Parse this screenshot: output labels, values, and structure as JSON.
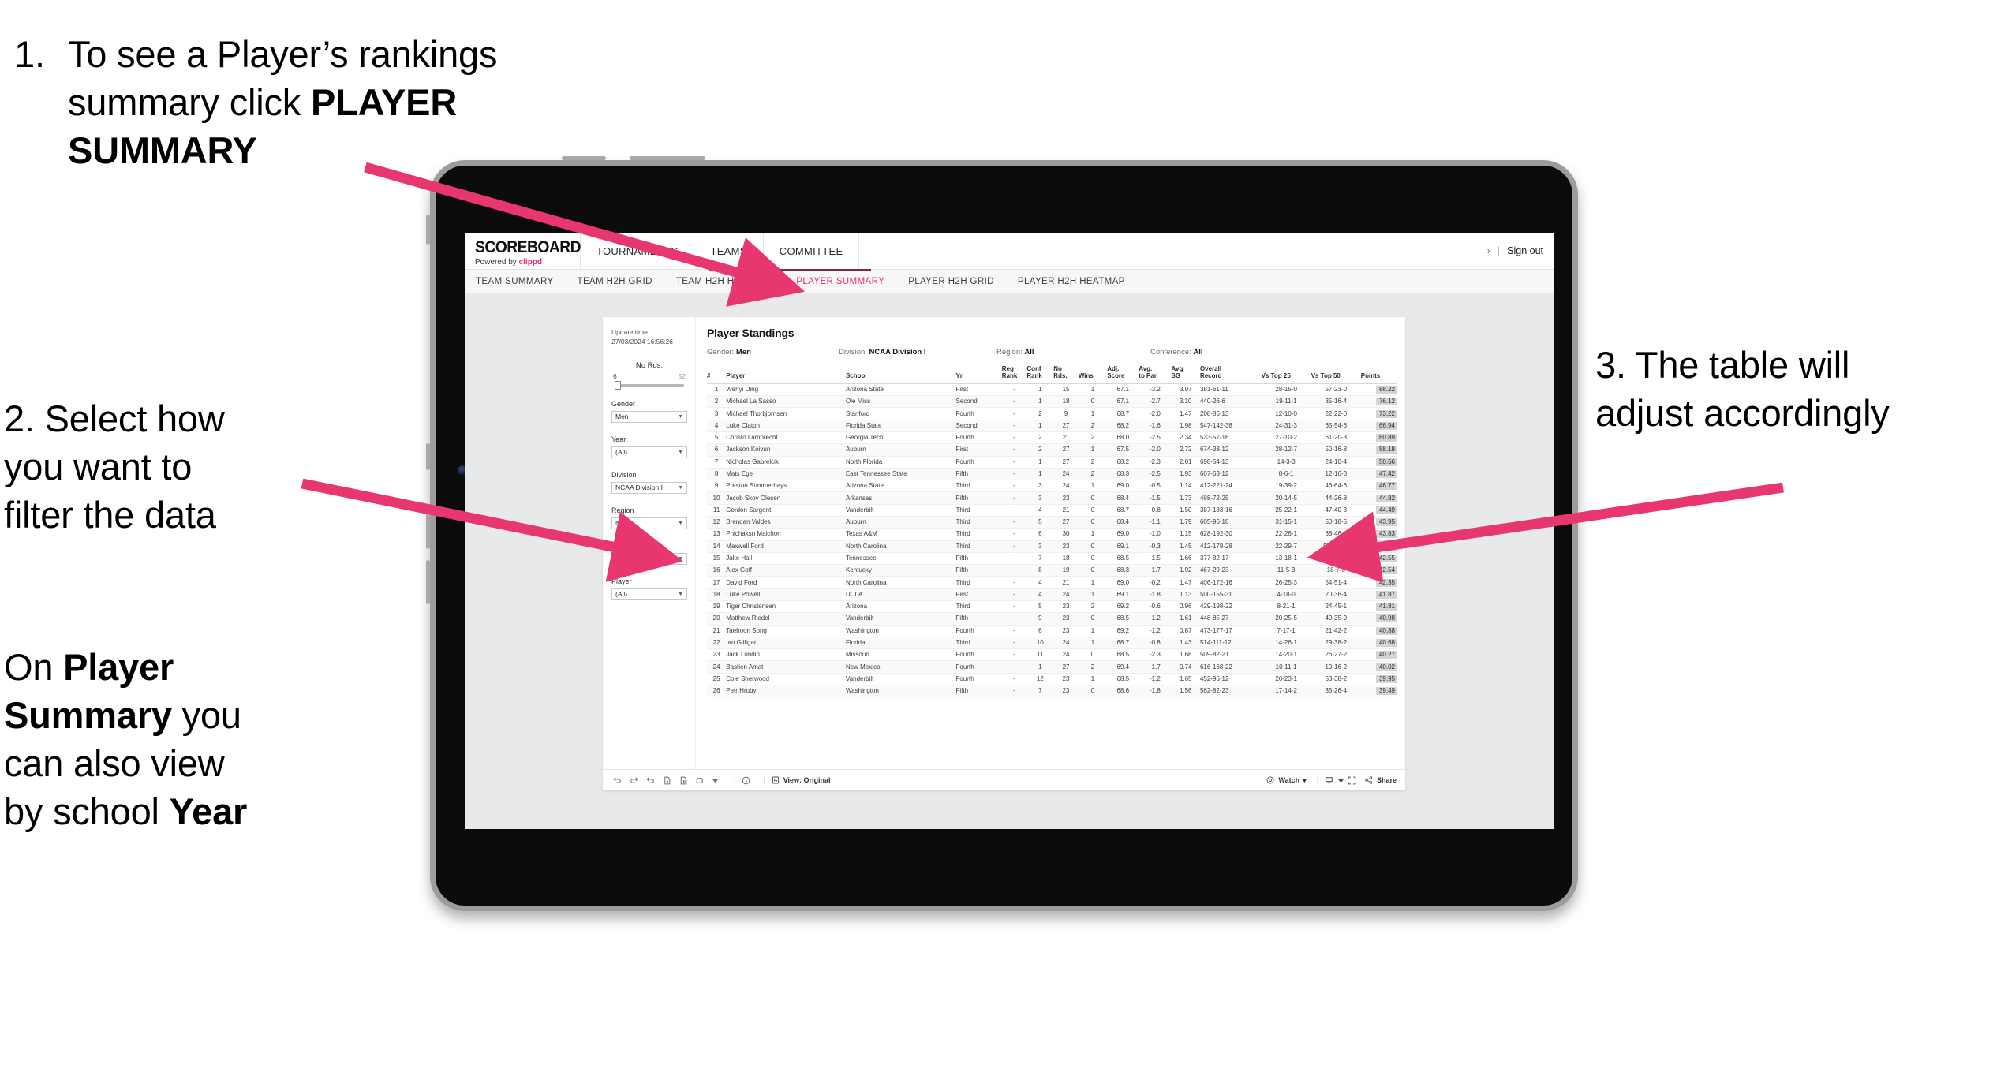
{
  "annotations": {
    "step1": {
      "number": "1.",
      "line1": "To see a Player’s rankings",
      "line2_plain": "summary click ",
      "line2_bold": "PLAYER",
      "line3_bold": "SUMMARY"
    },
    "step2": {
      "line1": "2. Select how",
      "line2": "you want to",
      "line3": "filter the data"
    },
    "step2b": {
      "seg1": "On ",
      "seg2_bold": "Player",
      "seg3_bold": "Summary",
      "seg4": " you",
      "seg5": "can also view",
      "seg6": "by school ",
      "seg7_bold": "Year"
    },
    "step3": {
      "line1": "3. The table will",
      "line2": "adjust accordingly"
    }
  },
  "colors": {
    "accent_pink": "#ef2a64",
    "arrow_pink": "#e8366f",
    "active_tab": "#ef2a64",
    "tab_underline": "#7a2742",
    "points_chip_bg": "#d2d4d6",
    "content_bg": "#e7e9eb"
  },
  "app": {
    "logo": {
      "main": "SCOREBOARD",
      "sub_prefix": "Powered by ",
      "sub_brand": "clippd"
    },
    "topnav": [
      {
        "label": "TOURNAMENTS"
      },
      {
        "label": "TEAMS"
      },
      {
        "label": "COMMITTEE"
      }
    ],
    "account": {
      "arrow": "›",
      "divider": "|",
      "signout_label": "Sign out"
    },
    "subnav": [
      {
        "label": "TEAM SUMMARY",
        "active": false
      },
      {
        "label": "TEAM H2H GRID",
        "active": false
      },
      {
        "label": "TEAM H2H HEATMAP",
        "active": false
      },
      {
        "label": "PLAYER SUMMARY",
        "active": true
      },
      {
        "label": "PLAYER H2H GRID",
        "active": false
      },
      {
        "label": "PLAYER H2H HEATMAP",
        "active": false
      }
    ]
  },
  "sheet": {
    "update_time_label": "Update time:",
    "update_time_value": "27/03/2024 16:56:26",
    "title": "Player Standings",
    "meta": [
      {
        "label": "Gender: ",
        "value": "Men"
      },
      {
        "label": "Division: ",
        "value": "NCAA Division I"
      },
      {
        "label": "Region: ",
        "value": "All"
      },
      {
        "label": "Conference: ",
        "value": "All"
      }
    ],
    "slider": {
      "title": "No Rds.",
      "min": "6",
      "max": "52"
    },
    "filters": [
      {
        "title": "Gender",
        "value": "Men"
      },
      {
        "title": "Year",
        "value": "(All)"
      },
      {
        "title": "Division",
        "value": "NCAA Division I"
      },
      {
        "title": "Region",
        "value": "N/A"
      },
      {
        "title": "Conference",
        "value": "(All)"
      },
      {
        "title": "Player",
        "value": "(All)"
      }
    ],
    "toolbar": {
      "view_label": "View: Original",
      "watch_label": "Watch",
      "share_label": "Share",
      "caret": "▾"
    }
  },
  "table": {
    "headers": [
      {
        "l1": "#",
        "l2": ""
      },
      {
        "l1": "Player",
        "l2": ""
      },
      {
        "l1": "School",
        "l2": ""
      },
      {
        "l1": "Yr",
        "l2": ""
      },
      {
        "l1": "Reg",
        "l2": "Rank"
      },
      {
        "l1": "Conf",
        "l2": "Rank"
      },
      {
        "l1": "No",
        "l2": "Rds."
      },
      {
        "l1": "Wins",
        "l2": ""
      },
      {
        "l1": "Adj.",
        "l2": "Score"
      },
      {
        "l1": "Avg.",
        "l2": "to Par"
      },
      {
        "l1": "Avg",
        "l2": "SG"
      },
      {
        "l1": "Overall",
        "l2": "Record"
      },
      {
        "l1": "Vs Top 25",
        "l2": ""
      },
      {
        "l1": "Vs Top 50",
        "l2": ""
      },
      {
        "l1": "Points",
        "l2": ""
      }
    ],
    "rows": [
      [
        "1",
        "Wenyi Ding",
        "Arizona State",
        "First",
        "-",
        "1",
        "15",
        "1",
        "67.1",
        "-3.2",
        "3.07",
        "381-61-11",
        "28-15-0",
        "57-23-0",
        "88.22"
      ],
      [
        "2",
        "Michael La Sasso",
        "Ole Miss",
        "Second",
        "-",
        "1",
        "18",
        "0",
        "67.1",
        "-2.7",
        "3.10",
        "440-26-6",
        "19-11-1",
        "35-16-4",
        "76.12"
      ],
      [
        "3",
        "Michael Thorbjornsen",
        "Stanford",
        "Fourth",
        "-",
        "2",
        "9",
        "1",
        "68.7",
        "-2.0",
        "1.47",
        "208-86-13",
        "12-10-0",
        "22-22-0",
        "73.22"
      ],
      [
        "4",
        "Luke Claton",
        "Florida State",
        "Second",
        "-",
        "1",
        "27",
        "2",
        "68.2",
        "-1.6",
        "1.98",
        "547-142-38",
        "24-31-3",
        "65-54-6",
        "66.94"
      ],
      [
        "5",
        "Christo Lamprecht",
        "Georgia Tech",
        "Fourth",
        "-",
        "2",
        "21",
        "2",
        "68.0",
        "-2.5",
        "2.34",
        "533-57-16",
        "27-10-2",
        "61-20-3",
        "60.89"
      ],
      [
        "6",
        "Jackson Koivun",
        "Auburn",
        "First",
        "-",
        "2",
        "27",
        "1",
        "67.5",
        "-2.0",
        "2.72",
        "674-33-12",
        "28-12-7",
        "50-16-8",
        "58.18"
      ],
      [
        "7",
        "Nicholas Gabrelcik",
        "North Florida",
        "Fourth",
        "-",
        "1",
        "27",
        "2",
        "68.2",
        "-2.3",
        "2.01",
        "698-54-13",
        "14-3-3",
        "24-10-4",
        "50.56"
      ],
      [
        "8",
        "Mats Ege",
        "East Tennessee State",
        "Fifth",
        "-",
        "1",
        "24",
        "2",
        "68.3",
        "-2.5",
        "1.93",
        "607-63-12",
        "8-6-1",
        "12-16-3",
        "47.42"
      ],
      [
        "9",
        "Preston Summerhays",
        "Arizona State",
        "Third",
        "-",
        "3",
        "24",
        "1",
        "69.0",
        "-0.5",
        "1.14",
        "412-221-24",
        "19-39-2",
        "46-64-6",
        "46.77"
      ],
      [
        "10",
        "Jacob Skov Olesen",
        "Arkansas",
        "Fifth",
        "-",
        "3",
        "23",
        "0",
        "68.4",
        "-1.5",
        "1.73",
        "488-72-25",
        "20-14-5",
        "44-26-8",
        "44.82"
      ],
      [
        "11",
        "Gordon Sargent",
        "Vanderbilt",
        "Third",
        "-",
        "4",
        "21",
        "0",
        "68.7",
        "-0.8",
        "1.50",
        "387-133-16",
        "25-22-1",
        "47-40-3",
        "44.49"
      ],
      [
        "12",
        "Brendan Valdes",
        "Auburn",
        "Third",
        "-",
        "5",
        "27",
        "0",
        "68.4",
        "-1.1",
        "1.79",
        "605-96-18",
        "31-15-1",
        "50-18-5",
        "43.95"
      ],
      [
        "13",
        "Phichaksn Maichon",
        "Texas A&M",
        "Third",
        "-",
        "6",
        "30",
        "1",
        "69.0",
        "-1.0",
        "1.15",
        "628-192-30",
        "22-26-1",
        "38-46-4",
        "43.83"
      ],
      [
        "14",
        "Maxwell Ford",
        "North Carolina",
        "Third",
        "-",
        "3",
        "23",
        "0",
        "69.1",
        "-0.3",
        "1.45",
        "412-178-28",
        "22-29-7",
        "52-51-10",
        "42.75"
      ],
      [
        "15",
        "Jake Hall",
        "Tennessee",
        "Fifth",
        "-",
        "7",
        "18",
        "0",
        "68.5",
        "-1.5",
        "1.66",
        "377-82-17",
        "13-18-1",
        "26-32-2",
        "42.55"
      ],
      [
        "16",
        "Alex Goff",
        "Kentucky",
        "Fifth",
        "-",
        "8",
        "19",
        "0",
        "68.3",
        "-1.7",
        "1.92",
        "467-29-23",
        "11-5-3",
        "18-7-3",
        "42.54"
      ],
      [
        "17",
        "David Ford",
        "North Carolina",
        "Third",
        "-",
        "4",
        "21",
        "1",
        "69.0",
        "-0.2",
        "1.47",
        "406-172-16",
        "26-25-3",
        "54-51-4",
        "42.35"
      ],
      [
        "18",
        "Luke Powell",
        "UCLA",
        "First",
        "-",
        "4",
        "24",
        "1",
        "69.1",
        "-1.8",
        "1.13",
        "500-155-31",
        "4-18-0",
        "20-36-4",
        "41.87"
      ],
      [
        "19",
        "Tiger Christensen",
        "Arizona",
        "Third",
        "-",
        "5",
        "23",
        "2",
        "69.2",
        "-0.6",
        "0.96",
        "429-198-22",
        "8-21-1",
        "24-45-1",
        "41.81"
      ],
      [
        "20",
        "Matthew Riedel",
        "Vanderbilt",
        "Fifth",
        "-",
        "9",
        "23",
        "0",
        "68.5",
        "-1.2",
        "1.61",
        "448-85-27",
        "20-25-5",
        "49-35-9",
        "40.98"
      ],
      [
        "21",
        "Taehoon Song",
        "Washington",
        "Fourth",
        "-",
        "6",
        "23",
        "1",
        "69.2",
        "-1.2",
        "0.87",
        "473-177-17",
        "7-17-1",
        "21-42-2",
        "40.88"
      ],
      [
        "22",
        "Ian Gilligan",
        "Florida",
        "Third",
        "-",
        "10",
        "24",
        "1",
        "68.7",
        "-0.8",
        "1.43",
        "514-111-12",
        "14-26-1",
        "29-38-2",
        "40.68"
      ],
      [
        "23",
        "Jack Lundin",
        "Missouri",
        "Fourth",
        "-",
        "11",
        "24",
        "0",
        "68.5",
        "-2.3",
        "1.68",
        "509-82-21",
        "14-20-1",
        "26-27-2",
        "40.27"
      ],
      [
        "24",
        "Bastien Amat",
        "New Mexico",
        "Fourth",
        "-",
        "1",
        "27",
        "2",
        "69.4",
        "-1.7",
        "0.74",
        "616-168-22",
        "10-11-1",
        "19-16-2",
        "40.02"
      ],
      [
        "25",
        "Cole Sherwood",
        "Vanderbilt",
        "Fourth",
        "-",
        "12",
        "23",
        "1",
        "68.5",
        "-1.2",
        "1.65",
        "452-96-12",
        "26-23-1",
        "53-38-2",
        "39.95"
      ],
      [
        "26",
        "Petr Hruby",
        "Washington",
        "Fifth",
        "-",
        "7",
        "23",
        "0",
        "68.6",
        "-1.8",
        "1.56",
        "562-82-23",
        "17-14-2",
        "35-26-4",
        "39.49"
      ]
    ]
  }
}
